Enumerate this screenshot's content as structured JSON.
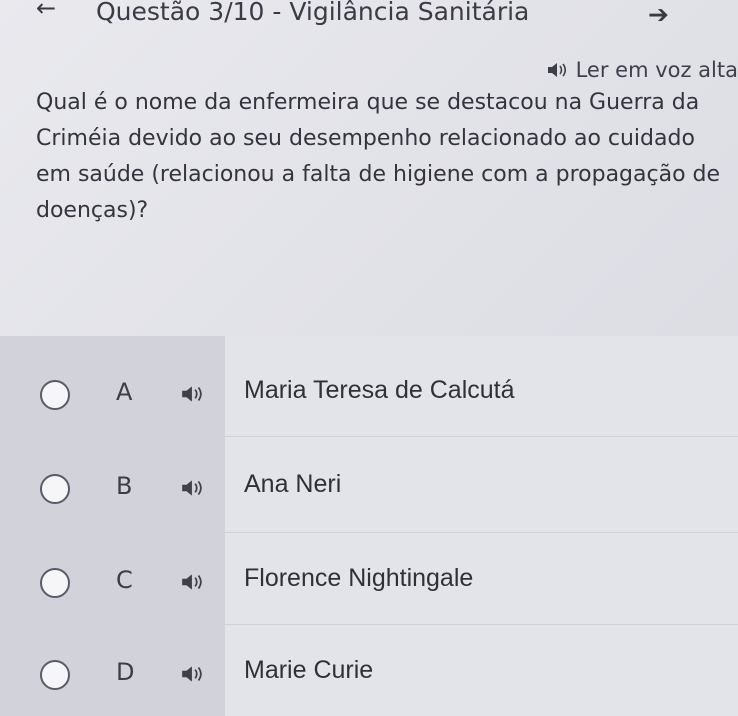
{
  "header": {
    "back_icon": "arrow-left-icon",
    "title": "Questão 3/10 - Vigilância Sanitária",
    "next_icon": "arrow-right-icon"
  },
  "read_aloud": {
    "icon": "speaker-icon",
    "label": "Ler em voz alta"
  },
  "question": {
    "text": "Qual é o nome da enfermeira que se destacou na Guerra da Criméia devido ao seu desempenho relacionado ao cuidado em saúde (relacionou a falta de higiene com a propagação de doenças)?"
  },
  "options": [
    {
      "letter": "A",
      "text": "Maria Teresa de Calcutá",
      "icon": "speaker-icon"
    },
    {
      "letter": "B",
      "text": "Ana Neri",
      "icon": "speaker-icon"
    },
    {
      "letter": "C",
      "text": "Florence Nightingale",
      "icon": "speaker-icon"
    },
    {
      "letter": "D",
      "text": "Marie Curie",
      "icon": "speaker-icon"
    }
  ],
  "colors": {
    "background": "#e4e5eb",
    "letters_column": "#d2d3da",
    "answers_column": "#e3e4ea",
    "text": "#2f3038"
  }
}
